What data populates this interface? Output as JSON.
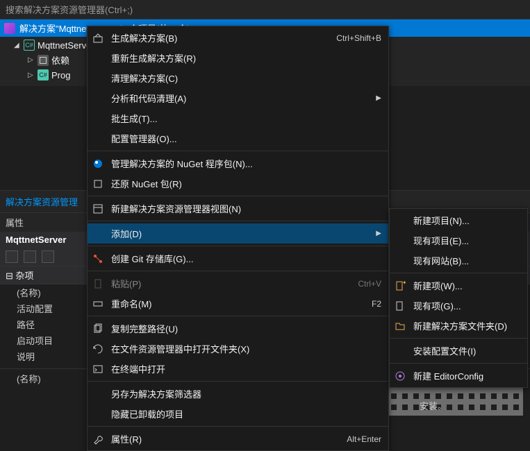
{
  "search": {
    "placeholder": "搜索解决方案资源管理器(Ctrl+;)"
  },
  "solution": {
    "label": "解决方案\"MqttnetServer\"(1 个项目/共 1 个)"
  },
  "tree": {
    "project": "MqttnetServer",
    "deps": "依赖",
    "program": "Prog"
  },
  "panelTab": "解决方案资源管理",
  "propsHeader": "属性",
  "propsTitle": "MqttnetServer",
  "propCat": "⊟ 杂项",
  "props": {
    "name": "(名称)",
    "activeCfg": "活动配置",
    "path": "路径",
    "startup": "启动项目",
    "desc": "说明",
    "name2": "(名称)"
  },
  "ctx": {
    "build": "生成解决方案(B)",
    "buildShort": "Ctrl+Shift+B",
    "rebuild": "重新生成解决方案(R)",
    "clean": "清理解决方案(C)",
    "analyze": "分析和代码清理(A)",
    "batch": "批生成(T)...",
    "config": "配置管理器(O)...",
    "nugetMgr": "管理解决方案的 NuGet 程序包(N)...",
    "nugetRestore": "还原 NuGet 包(R)",
    "newView": "新建解决方案资源管理器视图(N)",
    "add": "添加(D)",
    "git": "创建 Git 存储库(G)...",
    "paste": "粘贴(P)",
    "pasteShort": "Ctrl+V",
    "rename": "重命名(M)",
    "renameShort": "F2",
    "copyPath": "复制完整路径(U)",
    "openExplorer": "在文件资源管理器中打开文件夹(X)",
    "openTerminal": "在终端中打开",
    "saveAs": "另存为解决方案筛选器",
    "hideUnloaded": "隐藏已卸载的项目",
    "properties": "属性(R)",
    "propertiesShort": "Alt+Enter"
  },
  "sub": {
    "newProject": "新建项目(N)...",
    "existingProject": "现有项目(E)...",
    "existingWebsite": "现有网站(B)...",
    "newItem": "新建项(W)...",
    "existingItem": "现有项(G)...",
    "newSolutionFolder": "新建解决方案文件夹(D)",
    "installConfig": "安装配置文件(I)",
    "newEditorConfig": "新建 EditorConfig"
  },
  "installText": "安装。"
}
